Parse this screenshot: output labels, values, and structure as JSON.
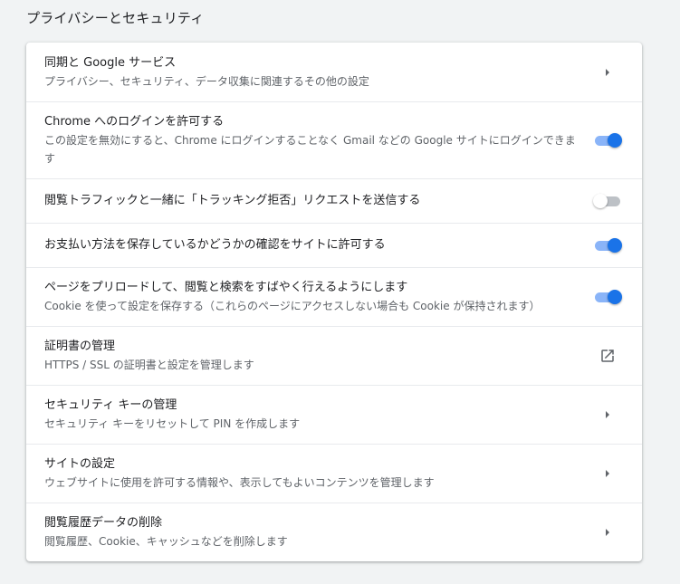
{
  "section": {
    "title": "プライバシーとセキュリティ"
  },
  "colors": {
    "accent": "#1a73e8",
    "accent_light": "#8ab4f8",
    "card": "#ffffff",
    "background": "#f1f3f4"
  },
  "rows": [
    {
      "label": "同期と Google サービス",
      "sub": "プライバシー、セキュリティ、データ収集に関連するその他の設定",
      "control": "arrow-right-icon"
    },
    {
      "label": "Chrome へのログインを許可する",
      "sub": "この設定を無効にすると、Chrome にログインすることなく Gmail などの Google サイトにログインできます",
      "control": "toggle",
      "checked": true
    },
    {
      "label": "閲覧トラフィックと一緒に「トラッキング拒否」リクエストを送信する",
      "control": "toggle",
      "checked": false
    },
    {
      "label": "お支払い方法を保存しているかどうかの確認をサイトに許可する",
      "control": "toggle",
      "checked": true
    },
    {
      "label": "ページをプリロードして、閲覧と検索をすばやく行えるようにします",
      "sub": "Cookie を使って設定を保存する（これらのページにアクセスしない場合も Cookie が保持されます）",
      "control": "toggle",
      "checked": true
    },
    {
      "label": "証明書の管理",
      "sub": "HTTPS / SSL の証明書と設定を管理します",
      "control": "open-in-new-icon"
    },
    {
      "label": "セキュリティ キーの管理",
      "sub": "セキュリティ キーをリセットして PIN を作成します",
      "control": "arrow-right-icon"
    },
    {
      "label": "サイトの設定",
      "sub": "ウェブサイトに使用を許可する情報や、表示してもよいコンテンツを管理します",
      "control": "arrow-right-icon"
    },
    {
      "label": "閲覧履歴データの削除",
      "sub": "閲覧履歴、Cookie、キャッシュなどを削除します",
      "control": "arrow-right-icon"
    }
  ]
}
